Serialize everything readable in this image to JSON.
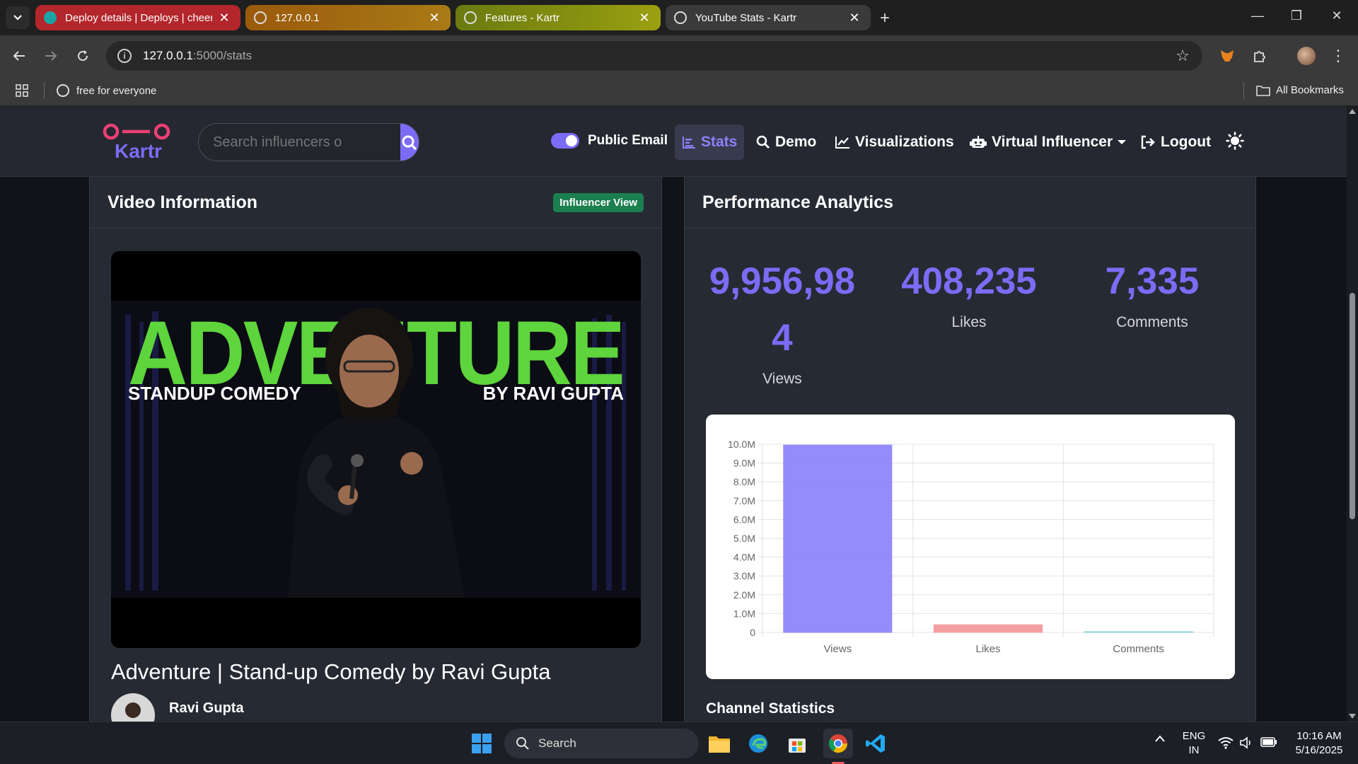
{
  "browser": {
    "tabs": [
      {
        "title": "Deploy details | Deploys | cheer",
        "color": "#b3262c"
      },
      {
        "title": "127.0.0.1",
        "color": "#a0680f"
      },
      {
        "title": "Features - Kartr",
        "color": "#8a9210"
      },
      {
        "title": "YouTube Stats - Kartr",
        "color": "#3a3a3a",
        "active": true
      }
    ],
    "url_host": "127.0.0.1",
    "url_path": ":5000/stats",
    "bookmarks": [
      {
        "label": "free for everyone"
      }
    ],
    "all_bookmarks_label": "All Bookmarks"
  },
  "app": {
    "logo_text": "Kartr",
    "brand_color": "#7b6cf6",
    "search_placeholder": "Search influencers o",
    "public_email_label": "Public Email",
    "public_email_on": true,
    "nav": [
      {
        "label": "Stats",
        "icon": "chart-bar-icon",
        "active": true
      },
      {
        "label": "Demo",
        "icon": "search-icon"
      },
      {
        "label": "Visualizations",
        "icon": "line-chart-icon"
      },
      {
        "label": "Virtual Influencer",
        "icon": "robot-icon",
        "dropdown": true
      },
      {
        "label": "Logout",
        "icon": "logout-icon"
      }
    ]
  },
  "video_card": {
    "heading": "Video Information",
    "badge": "Influencer View",
    "thumbnail_text": {
      "main": "ADVENTURE",
      "left": "STANDUP COMEDY",
      "right": "BY RAVI GUPTA"
    },
    "title": "Adventure | Stand-up Comedy by Ravi Gupta",
    "channel_name": "Ravi Gupta"
  },
  "analytics_card": {
    "heading": "Performance Analytics",
    "metrics": [
      {
        "value": "9,956,984",
        "label": "Views"
      },
      {
        "value": "408,235",
        "label": "Likes"
      },
      {
        "value": "7,335",
        "label": "Comments"
      }
    ],
    "channel_stats_heading": "Channel Statistics"
  },
  "chart_data": {
    "type": "bar",
    "categories": [
      "Views",
      "Likes",
      "Comments"
    ],
    "values": [
      9956984,
      408235,
      7335
    ],
    "colors": [
      "#8f86fa",
      "#f49a9c",
      "#7fd0d0"
    ],
    "ylim": [
      0,
      10000000
    ],
    "yticks": [
      "0",
      "1.0M",
      "2.0M",
      "3.0M",
      "4.0M",
      "5.0M",
      "6.0M",
      "7.0M",
      "8.0M",
      "9.0M",
      "10.0M"
    ],
    "grid": true
  },
  "taskbar": {
    "search_label": "Search",
    "lang_top": "ENG",
    "lang_bottom": "IN",
    "time": "10:16 AM",
    "date": "5/16/2025"
  }
}
